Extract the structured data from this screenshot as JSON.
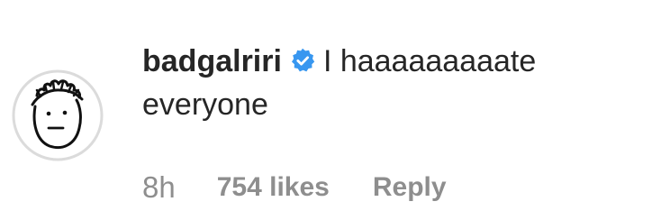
{
  "comment": {
    "username": "badgalriri",
    "verified_icon": "verified-badge-icon",
    "text": "I haaaaaaaaate everyone",
    "time": "8h",
    "likes": "754 likes",
    "reply_label": "Reply",
    "avatar_icon": "doodle-face-avatar-icon"
  },
  "colors": {
    "text": "#262626",
    "meta": "#8e8e8e",
    "verified": "#3897f0"
  }
}
